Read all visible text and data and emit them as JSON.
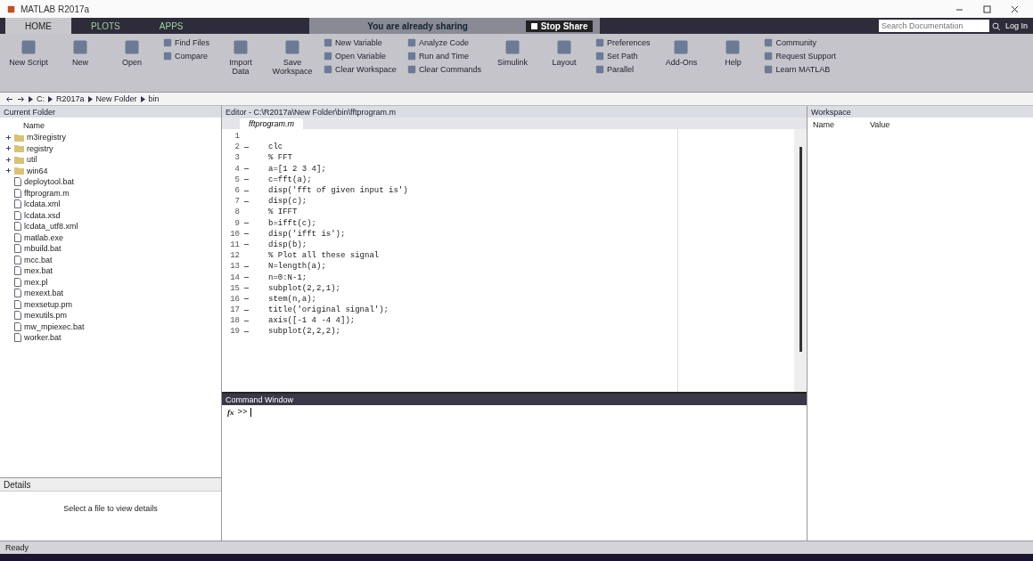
{
  "window": {
    "title": "MATLAB R2017a"
  },
  "tabs": [
    {
      "label": "HOME",
      "selected": true
    },
    {
      "label": "PLOTS",
      "selected": false
    },
    {
      "label": "APPS",
      "selected": false
    }
  ],
  "share": {
    "message": "You are already sharing",
    "stop_label": "Stop Share"
  },
  "search": {
    "placeholder": "Search Documentation"
  },
  "login_label": "Log In",
  "toolstrip": [
    {
      "kind": "large",
      "labels": [
        "New Script"
      ]
    },
    {
      "kind": "large",
      "labels": [
        "New"
      ]
    },
    {
      "kind": "large",
      "labels": [
        "Open"
      ]
    },
    {
      "kind": "stack",
      "labels": [
        "Find Files",
        "Compare"
      ]
    },
    {
      "kind": "large",
      "labels": [
        "Import Data"
      ]
    },
    {
      "kind": "large",
      "labels": [
        "Save Workspace"
      ]
    },
    {
      "kind": "stack",
      "labels": [
        "New Variable",
        "Open Variable",
        "Clear Workspace"
      ]
    },
    {
      "kind": "stack",
      "labels": [
        "Analyze Code",
        "Run and Time",
        "Clear Commands"
      ]
    },
    {
      "kind": "large",
      "labels": [
        "Simulink"
      ]
    },
    {
      "kind": "large",
      "labels": [
        "Layout"
      ]
    },
    {
      "kind": "stack",
      "labels": [
        "Preferences",
        "Set Path",
        "Parallel"
      ]
    },
    {
      "kind": "large",
      "labels": [
        "Add-Ons"
      ]
    },
    {
      "kind": "large",
      "labels": [
        "Help"
      ]
    },
    {
      "kind": "stack",
      "labels": [
        "Community",
        "Request Support",
        "Learn MATLAB"
      ]
    }
  ],
  "address": [
    "C:",
    "R2017a",
    "New Folder",
    "bin"
  ],
  "current_folder": {
    "title": "Current Folder",
    "column": "Name",
    "items": [
      {
        "name": "m3iregistry",
        "kind": "folder"
      },
      {
        "name": "registry",
        "kind": "folder"
      },
      {
        "name": "util",
        "kind": "folder"
      },
      {
        "name": "win64",
        "kind": "folder"
      },
      {
        "name": "deploytool.bat",
        "kind": "file"
      },
      {
        "name": "fftprogram.m",
        "kind": "file"
      },
      {
        "name": "lcdata.xml",
        "kind": "file"
      },
      {
        "name": "lcdata.xsd",
        "kind": "file"
      },
      {
        "name": "lcdata_utf8.xml",
        "kind": "file"
      },
      {
        "name": "matlab.exe",
        "kind": "file"
      },
      {
        "name": "mbuild.bat",
        "kind": "file"
      },
      {
        "name": "mcc.bat",
        "kind": "file"
      },
      {
        "name": "mex.bat",
        "kind": "file"
      },
      {
        "name": "mex.pl",
        "kind": "file"
      },
      {
        "name": "mexext.bat",
        "kind": "file"
      },
      {
        "name": "mexsetup.pm",
        "kind": "file"
      },
      {
        "name": "mexutils.pm",
        "kind": "file"
      },
      {
        "name": "mw_mpiexec.bat",
        "kind": "file"
      },
      {
        "name": "worker.bat",
        "kind": "file"
      }
    ]
  },
  "details": {
    "title": "Details",
    "message": "Select a file to view details"
  },
  "editor": {
    "title": "Editor - C:\\R2017a\\New Folder\\bin\\fftprogram.m",
    "tabs": [
      {
        "label": "fftprogram.m",
        "selected": true
      }
    ],
    "lines": [
      {
        "number": "1",
        "executable": false
      },
      {
        "number": "2",
        "executable": true,
        "code": "clc"
      },
      {
        "number": "3",
        "executable": false,
        "code": "% FFT"
      },
      {
        "number": "4",
        "executable": true,
        "code": "a=[1 2 3 4];"
      },
      {
        "number": "5",
        "executable": true,
        "code": "c=fft(a);"
      },
      {
        "number": "6",
        "executable": true,
        "code": "disp('fft of given input is')"
      },
      {
        "number": "7",
        "executable": true,
        "code": "disp(c);"
      },
      {
        "number": "8",
        "executable": false,
        "code": "% IFFT"
      },
      {
        "number": "9",
        "executable": true,
        "code": "b=ifft(c);"
      },
      {
        "number": "10",
        "executable": true,
        "code": "disp('ifft is');"
      },
      {
        "number": "11",
        "executable": true,
        "code": "disp(b);"
      },
      {
        "number": "12",
        "executable": false,
        "code": "% Plot all these signal"
      },
      {
        "number": "13",
        "executable": true,
        "code": "N=length(a);"
      },
      {
        "number": "14",
        "executable": true,
        "code": "n=0:N-1;"
      },
      {
        "number": "15",
        "executable": true,
        "code": "subplot(2,2,1);"
      },
      {
        "number": "16",
        "executable": true,
        "code": "stem(n,a);"
      },
      {
        "number": "17",
        "executable": true,
        "code": "title('original signal');"
      },
      {
        "number": "18",
        "executable": true,
        "code": "axis([-1 4 -4 4]);"
      },
      {
        "number": "19",
        "executable": true,
        "code": "subplot(2,2,2);"
      }
    ]
  },
  "command_window": {
    "title": "Command Window",
    "function_icon": "fx",
    "prompt": ">>"
  },
  "workspace": {
    "title": "Workspace",
    "columns": [
      "Name",
      "Value"
    ]
  },
  "status": "Ready"
}
